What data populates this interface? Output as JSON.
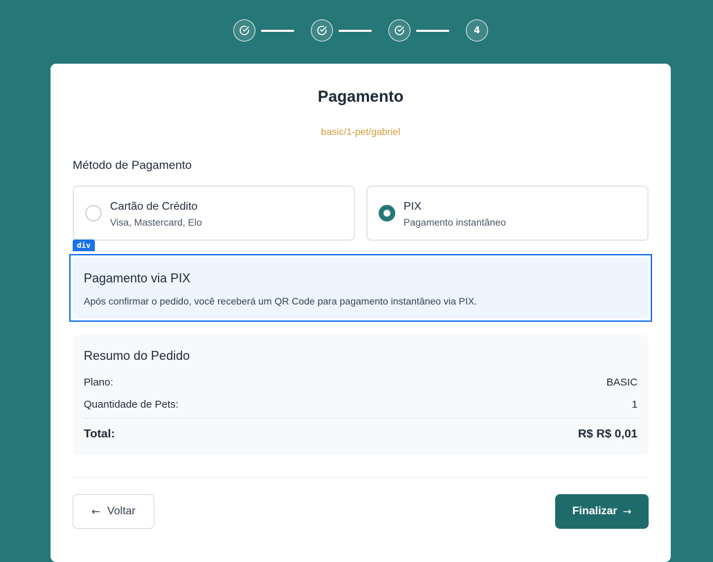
{
  "stepper": {
    "steps": [
      {
        "state": "done",
        "icon": "check-circle-icon"
      },
      {
        "state": "done",
        "icon": "check-circle-icon"
      },
      {
        "state": "done",
        "icon": "check-circle-icon"
      },
      {
        "state": "current",
        "label": "4"
      }
    ]
  },
  "page": {
    "title": "Pagamento",
    "subtitle": "basic/1-pet/gabriel"
  },
  "payment": {
    "section_label": "Método de Pagamento",
    "methods": [
      {
        "title": "Cartão de Crédito",
        "desc": "Visa, Mastercard, Elo",
        "selected": false
      },
      {
        "title": "PIX",
        "desc": "Pagamento instantâneo",
        "selected": true
      }
    ],
    "inspector_tag": "div",
    "pix_box": {
      "title": "Pagamento via PIX",
      "text": "Após confirmar o pedido, você receberá um QR Code para pagamento instantâneo via PIX."
    }
  },
  "summary": {
    "title": "Resumo do Pedido",
    "rows": [
      {
        "label": "Plano:",
        "value": "BASIC"
      },
      {
        "label": "Quantidade de Pets:",
        "value": "1"
      }
    ],
    "total_label": "Total:",
    "total_value": "R$ R$ 0,01"
  },
  "actions": {
    "back_label": "Voltar",
    "finish_label": "Finalizar",
    "back_icon": "arrow-left-icon",
    "finish_icon": "arrow-right-icon"
  },
  "colors": {
    "background": "#267777",
    "primary": "#1f6b6b",
    "subtitle": "#d69e3a",
    "inspector_highlight": "#1a73e8"
  }
}
